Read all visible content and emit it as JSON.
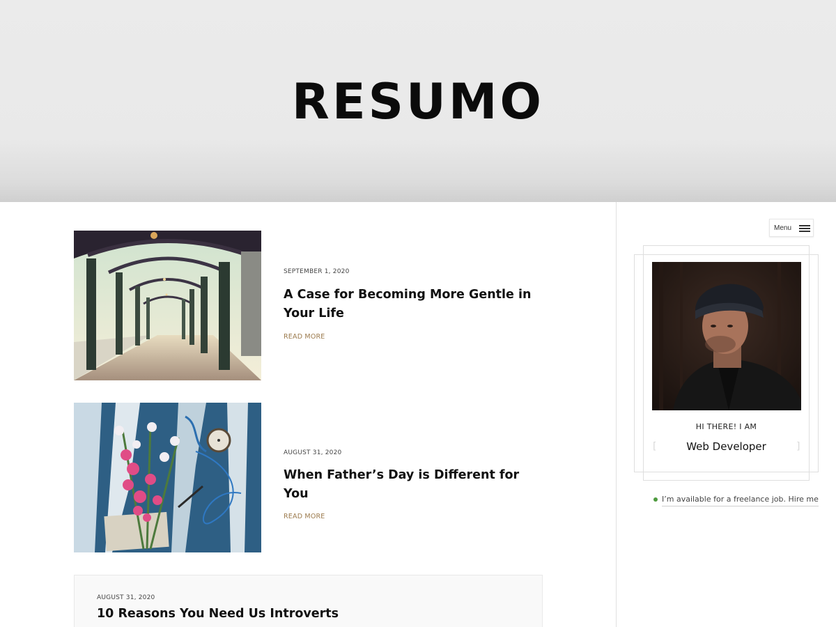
{
  "site": {
    "logo": "RESUMO"
  },
  "posts": [
    {
      "date": "SEPTEMBER 1, 2020",
      "title": "A Case for Becoming More Gentle in Your Life",
      "read_more": "READ MORE"
    },
    {
      "date": "AUGUST 31, 2020",
      "title": "When Father’s Day is Different for You",
      "read_more": "READ MORE"
    },
    {
      "date": "AUGUST 31, 2020",
      "title": "10 Reasons You Need Us Introverts"
    }
  ],
  "sidebar": {
    "menu_label": "Menu",
    "greeting": "HI THERE! I AM",
    "role": "Web Developer",
    "availability": "I’m available for a freelance job. Hire me"
  },
  "colors": {
    "accent_link": "#9b7a4c",
    "status_available": "#4d9a3e",
    "hero_background": "#ebebeb"
  },
  "icons": {
    "menu": "hamburger-icon",
    "status": "status-dot-icon"
  }
}
